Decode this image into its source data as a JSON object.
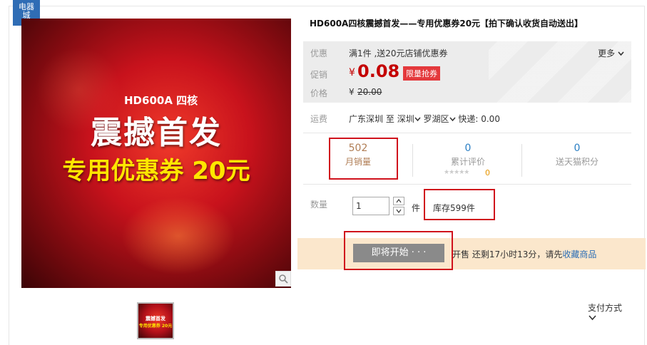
{
  "badge": {
    "line1": "电器",
    "line2": "城"
  },
  "main_image": {
    "model": "HD600A 四核",
    "headline": "震撼首发",
    "coupon": "专用优惠券 20元"
  },
  "thumbnail": {
    "line1": "震撼首发",
    "line2": "专用优惠券 20元"
  },
  "product": {
    "title": "HD600A四核震撼首发——专用优惠券20元【拍下确认收货自动送出】"
  },
  "price_box": {
    "coupon_label": "优惠",
    "coupon_text": "满1件 ,送20元店铺优惠券",
    "more_label": "更多",
    "promo_label": "促销",
    "currency": "¥",
    "promo_price": "0.08",
    "promo_tag": "限量抢券",
    "orig_label": "价格",
    "orig_price": "20.00"
  },
  "shipping": {
    "label": "运费",
    "from": "广东深圳",
    "to_word": "至",
    "city": "深圳",
    "district": "罗湖区",
    "express": "快递: 0.00"
  },
  "stats": {
    "monthly_sales": "502",
    "monthly_sales_label": "月销量",
    "reviews": "0",
    "reviews_label": "累计评价",
    "review_stars": "★★★★★",
    "review_count": "0",
    "points": "0",
    "points_label": "送天猫积分"
  },
  "quantity": {
    "label": "数量",
    "value": "1",
    "unit": "件",
    "stock": "库存599件"
  },
  "buy": {
    "button_label": "即将开始 · · ·",
    "note_prefix": "开售 还剩17小时13分，请先",
    "note_link": "收藏商品"
  },
  "payment": {
    "label": "支付方式"
  },
  "colors": {
    "price_red": "#c40000",
    "promo_tag_bg": "#e4393c",
    "link_blue": "#2a6db5",
    "highlight_red": "#d0121c",
    "buy_bar_bg": "#fbe7cc",
    "button_gray": "#8a8a8a"
  }
}
